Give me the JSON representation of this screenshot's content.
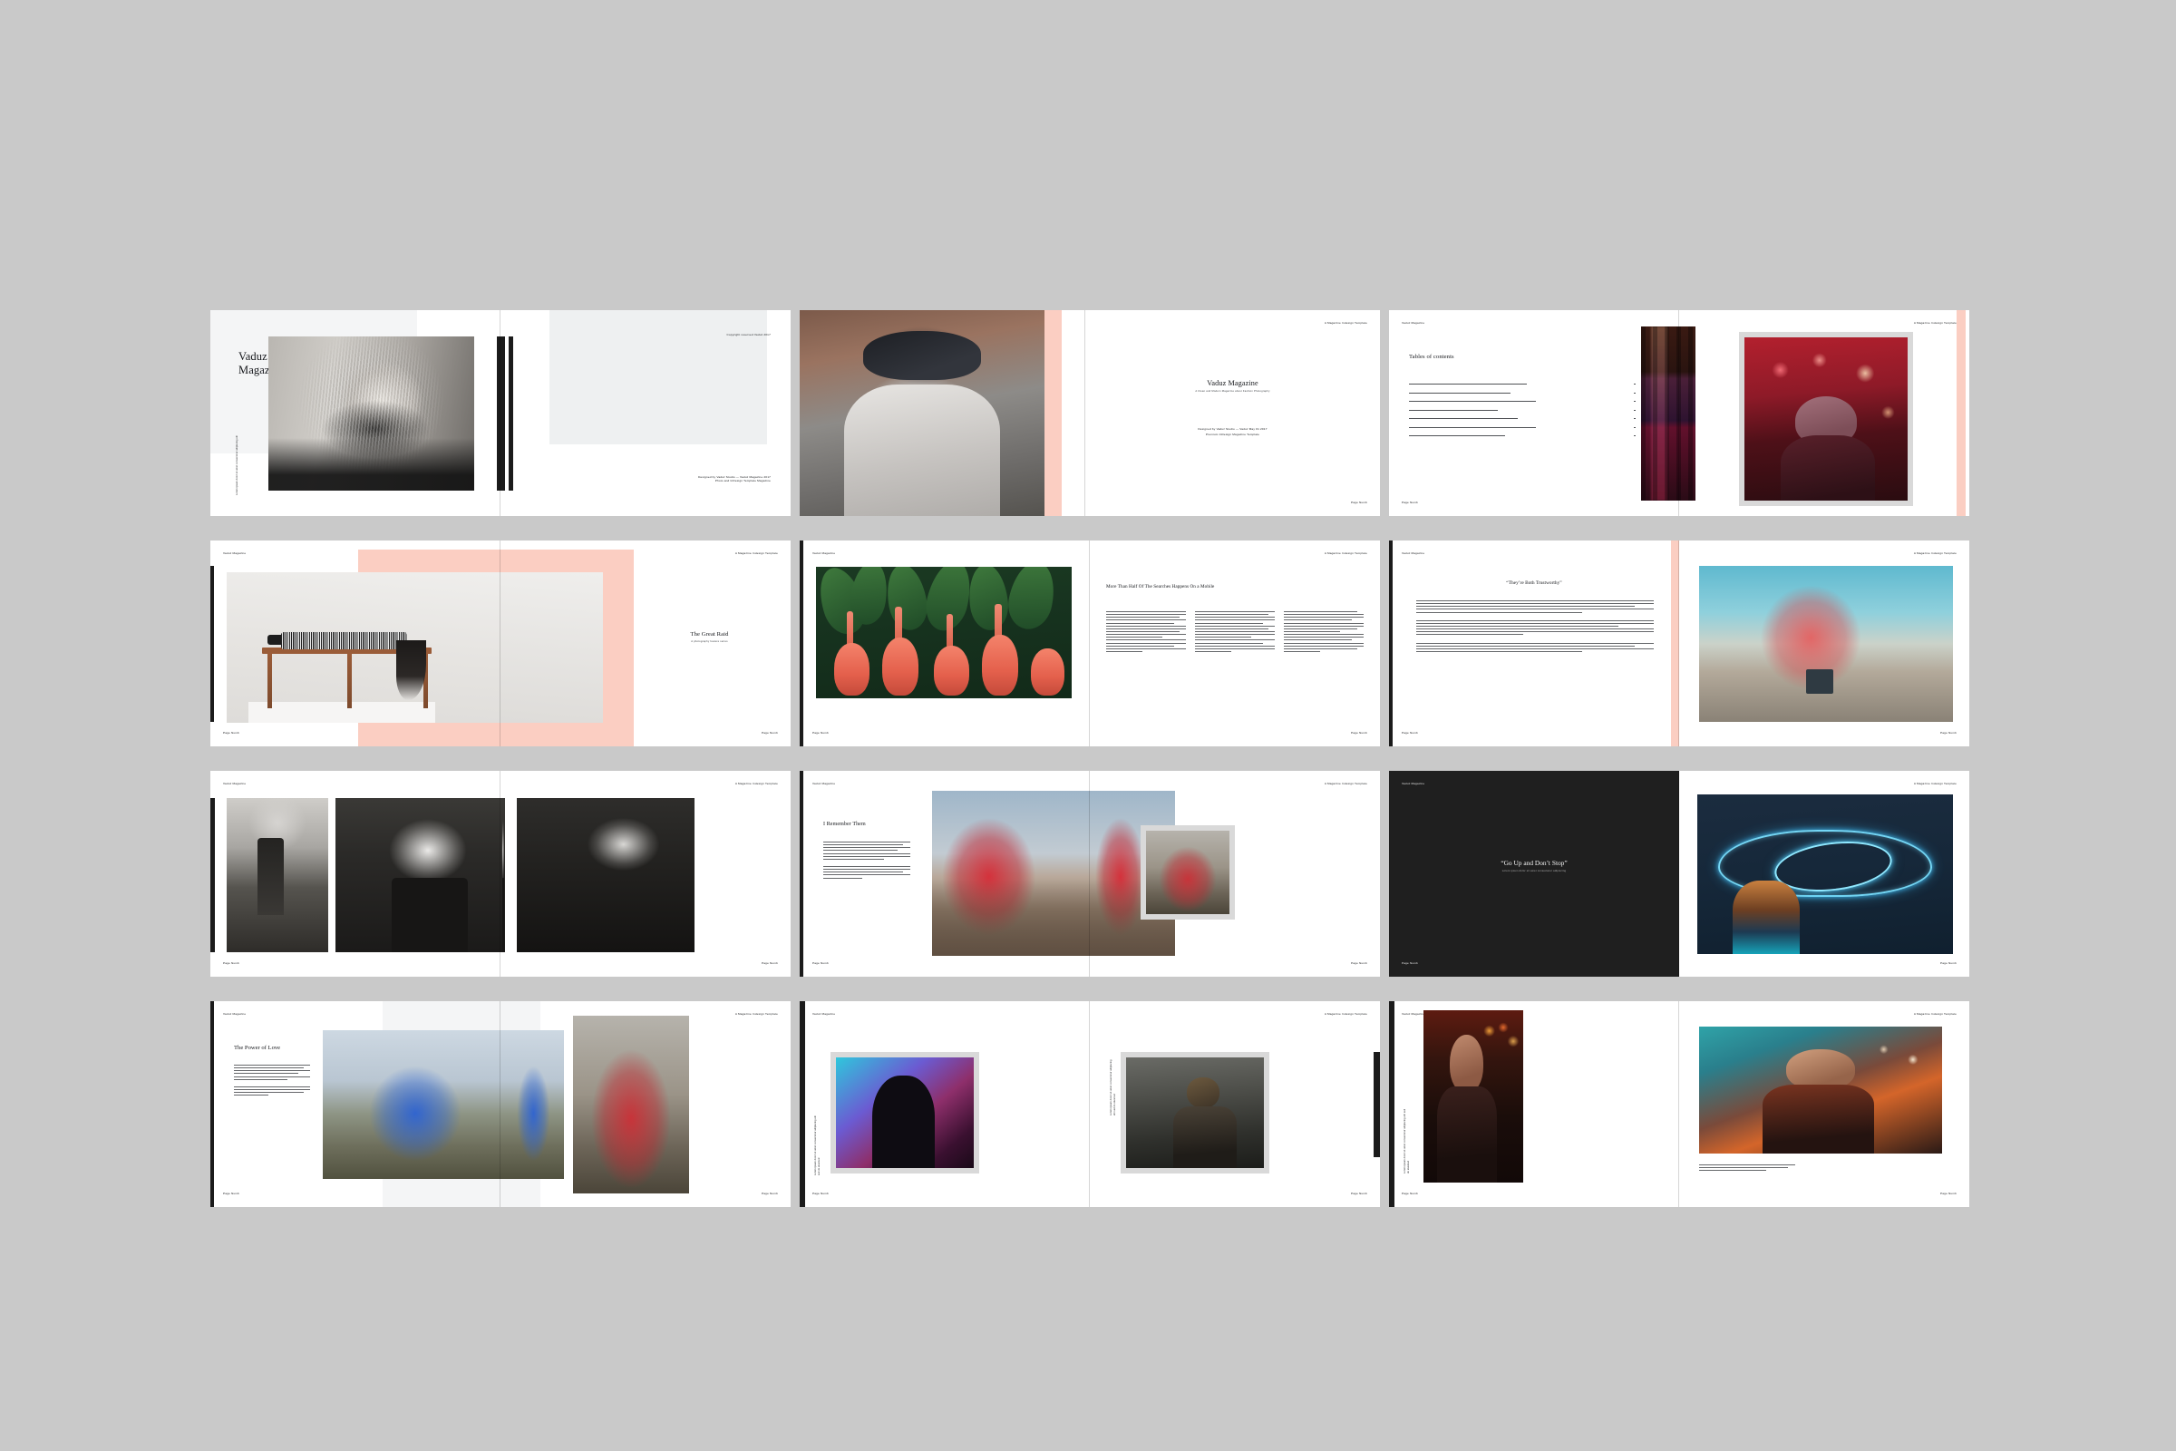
{
  "document": {
    "product_title": "Vaduz Magazine",
    "product_subtitle": "A Magazine Indesign Template",
    "background_color": "#c9c9c9",
    "accent_pink": "#fbcec2",
    "accent_black": "#1b1b1b",
    "accent_gray": "#eef0f1"
  },
  "running_head": {
    "left": "Vaduz Magazine",
    "right": "A Magazine Indesign Template",
    "folio_left": "Page Numb",
    "folio_right": "Page Numb"
  },
  "side_caption": {
    "cover": "Lorem ipsum dolor sit amet consectetur adipiscing elit sed do",
    "body": "Lorem ipsum dolor sit amet, consectetur adipiscing elit, sed do eiusmod tempor incididunt ut labore et dolore magna aliqua. Ut enim ad minim veniam, quis nostrud."
  },
  "spreads": [
    {
      "index": 1,
      "name": "cover-spread",
      "left_page": {
        "title": "Vaduz\nMagazine",
        "title_line_1": "Vaduz",
        "title_line_2": "Magazine",
        "side_caption": "Lorem ipsum dolor sit amet consectetur adipiscing elit",
        "photo": "black-and-white-blonde-portrait"
      },
      "right_page": {
        "top_note": "Copyright reserved Vaduz 2017",
        "footer_line_1": "Designed by Vaduz Studio — Vaduz Magazine 2017",
        "footer_line_2": "Photo and InDesign Template Magazine"
      }
    },
    {
      "index": 2,
      "name": "title-spread",
      "left_page": {
        "photo": "man-in-cap-writing-notebook"
      },
      "right_page": {
        "title": "Vaduz Magazine",
        "subtitle": "A Clean and Modern Magazine about Fashion Photography",
        "credit_line_1": "Designed by Vaduz Studio — Vaduz May 01 2017",
        "credit_line_2": "Premium InDesign Magazine Template"
      }
    },
    {
      "index": 3,
      "name": "table-of-contents-spread",
      "left_page": {
        "title": "Tables of contents",
        "items": [
          {
            "label": "Lorem ipsum dolor sit amet consectetur adipiscing elit",
            "page": "1"
          },
          {
            "label": "Consectetur adipiscing elit sed do eiusmod tempor",
            "page": "2"
          },
          {
            "label": "Sed do eiusmod tempor incididunt ut labore et dolore magna",
            "page": "3"
          },
          {
            "label": "Ut enim ad minim veniam quis nostrud exercitation",
            "page": "4"
          },
          {
            "label": "Duis aute irure dolor in reprehenderit in voluptate velit",
            "page": "5"
          },
          {
            "label": "Excepteur sint occaecat cupidatat non proident sunt in culpa",
            "page": "6"
          },
          {
            "label": "Qui officia deserunt mollit anim id est laborum",
            "page": "7"
          }
        ]
      },
      "right_page": {
        "photo_left": "neon-girls-sign",
        "photo_right": "woman-in-beanie-red-bokeh"
      }
    },
    {
      "index": 4,
      "name": "the-great-raid-spread",
      "left_page": {
        "photo": "woman-lying-on-table-gallery"
      },
      "right_page": {
        "title": "The Great Raid",
        "subtitle": "A photography feature series"
      }
    },
    {
      "index": 5,
      "name": "article-spread-flamingos",
      "left_page": {
        "photo": "flamingos-among-palm-leaves"
      },
      "right_page": {
        "title": "More Than Half Of The Searches Happens On a Mobile",
        "columns": 3,
        "body": "Lorem ipsum dolor sit amet, consectetur adipiscing elit, sed do eiusmod tempor incididunt ut labore et dolore magna aliqua. Ut enim ad minim veniam, quis nostrud exercitation ullamco laboris nisi ut aliquip ex ea commodo consequat."
      }
    },
    {
      "index": 6,
      "name": "quote-spread-trustworthy",
      "left_page": {
        "title": "“They’re Both Trustworthy”",
        "body": "Lorem ipsum dolor sit amet, consectetur adipiscing elit, sed do eiusmod tempor incididunt ut labore et dolore magna aliqua. Ut enim ad minim veniam, quis nostrud exercitation."
      },
      "right_page": {
        "photo": "red-smoke-bomb-on-beach"
      }
    },
    {
      "index": 7,
      "name": "photo-triptych-spread",
      "left_page": {
        "photo_1": "man-sitting-on-bench-bw",
        "photo_2": "man-smoking-cigarette-bw"
      },
      "right_page": {
        "photo_3": "man-exhaling-smoke-bw"
      }
    },
    {
      "index": 8,
      "name": "i-remember-them-spread",
      "left_page": {
        "title": "I Remember Them",
        "body": "Lorem ipsum dolor sit amet, consectetur adipiscing elit, sed do eiusmod tempor incididunt ut labore et dolore magna aliqua enim."
      },
      "right_page": {
        "photo_main": "red-smoke-desert-walker",
        "photo_inset": "red-smoke-portrait"
      }
    },
    {
      "index": 9,
      "name": "quote-spread-go-up",
      "left_page": {
        "title": "“Go Up and Don’t Stop”",
        "subtitle": "Lorem ipsum dolor sit amet consectetur adipiscing",
        "background": "#1f1f1f"
      },
      "right_page": {
        "photo": "blue-neon-script-sign-wall"
      }
    },
    {
      "index": 10,
      "name": "the-power-of-love-spread",
      "left_page": {
        "title": "The Power of Love",
        "body": "Lorem ipsum dolor sit amet, consectetur adipiscing elit, sed do eiusmod tempor incididunt ut labore et dolore magna aliqua.",
        "photo": "blue-smoke-landscape"
      },
      "right_page": {
        "photo": "red-smoke-man-in-field"
      }
    },
    {
      "index": 11,
      "name": "portrait-gallery-spread",
      "left_page": {
        "photo": "gradient-silhouette-portrait",
        "side_caption": "Lorem ipsum dolor sit amet consectetur adipiscing elit sed do eiusmod"
      },
      "right_page": {
        "photo": "man-with-bandana-portrait",
        "side_caption": "Lorem ipsum dolor sit amet consectetur adipiscing elit sed do eiusmod"
      }
    },
    {
      "index": 12,
      "name": "street-portraits-spread",
      "left_page": {
        "photo": "woman-with-glasses-neon-marquee",
        "side_caption": "Lorem ipsum dolor sit amet consectetur adipiscing elit sed do eiusmod"
      },
      "right_page": {
        "photo": "woman-at-fairground-lights",
        "caption": "Lorem ipsum dolor sit amet, consectetur adipiscing elit, sed do eiusmod tempor incididunt ut labore et dolore magna aliqua."
      }
    }
  ]
}
